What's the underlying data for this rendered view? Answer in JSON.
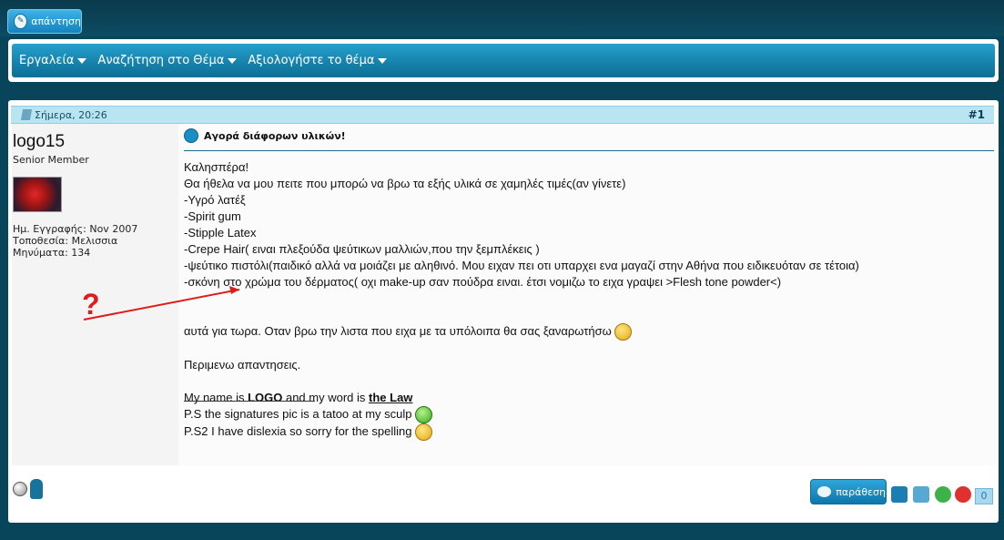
{
  "reply_button": {
    "label": "απάντηση"
  },
  "toolbar": {
    "items": [
      "Εργαλεία",
      "Αναζήτηση στο Θέμα",
      "Αξιολογήστε το θέμα"
    ]
  },
  "post": {
    "date": "Σήμερα, 20:26",
    "number": "#1",
    "author": {
      "name": "logo15",
      "title": "Senior Member",
      "join_date": "Ημ. Εγγραφής: Nov 2007",
      "location": "Τοποθεσία: Μελισσια",
      "posts": "Μηνύματα: 134"
    },
    "title": "Αγορά διάφορων υλικών!",
    "body": [
      "Καλησπέρα!",
      "Θα ήθελα να μου πειτε που μπορώ να βρω τα εξής υλικά σε χαμηλές τιμές(αν γίνετε)",
      "",
      "-Υγρό λατέξ",
      "-Spirit gum",
      "-Stipple Latex",
      "-Crepe Hair( ειναι πλεξούδα ψεύτικων μαλλιών,που την ξεμπλέκεις )",
      "-ψεύτικο πιστόλι(παιδικό αλλά να μοιάζει με αληθινό. Μου ειχαν πει οτι υπαρχει ενα μαγαζί στην Αθήνα που ειδικευόταν σε τέτοια)",
      "-σκόνη στο χρώμα του δέρματος( οχι make-up σαν πούδρα ειναι. έτσι νομιζω το ειχα γραψει >Flesh tone powder<)",
      "",
      "",
      "αυτά για τωρα. Οταν βρω την λιστα που ειχα με τα υπόλοιπα θα σας ξαναρωτήσω",
      "",
      "Περιμενω απαντησεις."
    ],
    "signature": {
      "line1_a": "My name is ",
      "line1_b": "LOGO",
      "line1_c": " and my word is ",
      "line1_d": "the Law",
      "line2": "P.S the signatures pic is a tatoo at my sculp",
      "line3": "P.S2 I have dislexia so sorry for the spelling"
    }
  },
  "annotation": {
    "symbol": "?",
    "color": "#e01b1b"
  },
  "quote_button": {
    "label": "παράθεση"
  },
  "rating_count": "0",
  "colors": {
    "accent": "#1786b0",
    "background": "#08445a"
  }
}
